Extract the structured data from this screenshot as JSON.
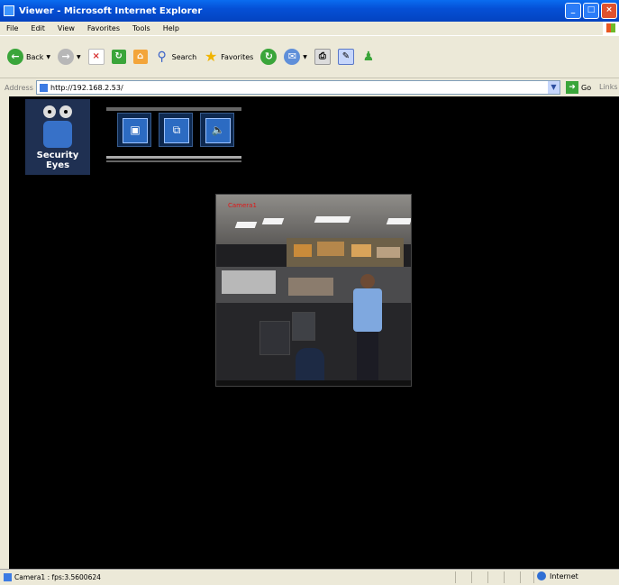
{
  "window": {
    "title": "Viewer - Microsoft Internet Explorer",
    "buttons": [
      "_",
      "□",
      "×"
    ]
  },
  "menu": [
    "File",
    "Edit",
    "View",
    "Favorites",
    "Tools",
    "Help"
  ],
  "toolbar": {
    "back": "Back",
    "search": "Search",
    "favorites": "Favorites"
  },
  "address": {
    "label": "Address",
    "url": "http://192.168.2.53/",
    "go": "Go",
    "links": "Links"
  },
  "page": {
    "logo_text": "Security Eyes",
    "video_label": "Camera1"
  },
  "status": {
    "text": "Camera1 : fps:3.5600624",
    "zone": "Internet"
  },
  "colors": {
    "titlebar": "#0550d6",
    "page_background": "#000000",
    "video_label": "#e01717",
    "logo_panel": "#1f3052"
  }
}
